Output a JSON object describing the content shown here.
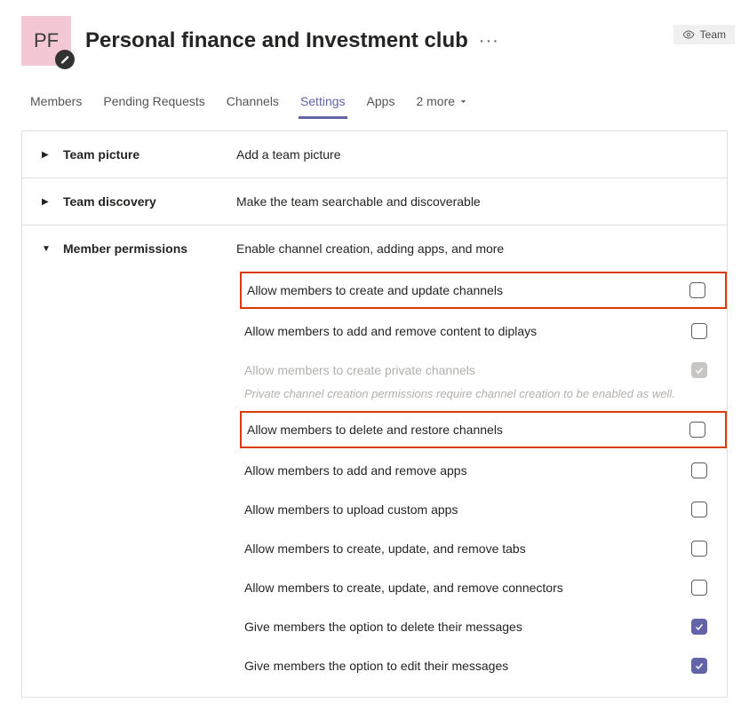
{
  "header": {
    "avatar_initials": "PF",
    "title": "Personal finance and Investment club",
    "visibility_label": "Team"
  },
  "tabs": {
    "items": [
      {
        "label": "Members",
        "active": false
      },
      {
        "label": "Pending Requests",
        "active": false
      },
      {
        "label": "Channels",
        "active": false
      },
      {
        "label": "Settings",
        "active": true
      },
      {
        "label": "Apps",
        "active": false
      }
    ],
    "more_label": "2 more"
  },
  "sections": {
    "team_picture": {
      "title": "Team picture",
      "desc": "Add a team picture"
    },
    "team_discovery": {
      "title": "Team discovery",
      "desc": "Make the team searchable and discoverable"
    },
    "member_permissions": {
      "title": "Member permissions",
      "desc": "Enable channel creation, adding apps, and more",
      "permissions": [
        {
          "label": "Allow members to create and update channels",
          "checked": false,
          "disabled": false,
          "highlighted": true
        },
        {
          "label": "Allow members to add and remove content to diplays",
          "checked": false,
          "disabled": false,
          "highlighted": false
        },
        {
          "label": "Allow members to create private channels",
          "checked": true,
          "disabled": true,
          "highlighted": false,
          "help": "Private channel creation permissions require channel creation to be enabled as well."
        },
        {
          "label": "Allow members to delete and restore channels",
          "checked": false,
          "disabled": false,
          "highlighted": true
        },
        {
          "label": "Allow members to add and remove apps",
          "checked": false,
          "disabled": false,
          "highlighted": false
        },
        {
          "label": "Allow members to upload custom apps",
          "checked": false,
          "disabled": false,
          "highlighted": false
        },
        {
          "label": "Allow members to create, update, and remove tabs",
          "checked": false,
          "disabled": false,
          "highlighted": false
        },
        {
          "label": "Allow members to create, update, and remove connectors",
          "checked": false,
          "disabled": false,
          "highlighted": false
        },
        {
          "label": "Give members the option to delete their messages",
          "checked": true,
          "disabled": false,
          "highlighted": false
        },
        {
          "label": "Give members the option to edit their messages",
          "checked": true,
          "disabled": false,
          "highlighted": false
        }
      ]
    }
  }
}
